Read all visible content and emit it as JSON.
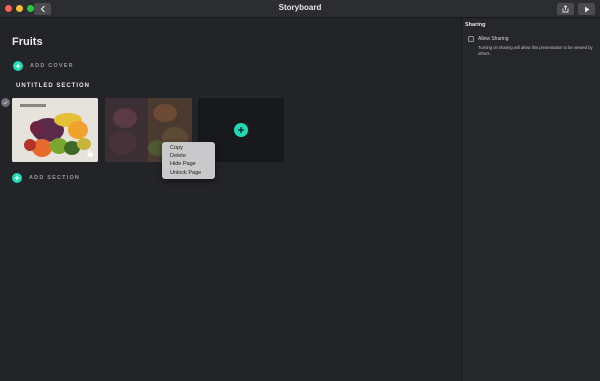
{
  "window": {
    "title": "Storyboard"
  },
  "document": {
    "title": "Fruits",
    "add_cover_label": "ADD COVER",
    "add_section_label": "ADD SECTION",
    "section_title": "UNTITLED SECTION"
  },
  "context_menu": {
    "items": [
      "Copy",
      "Delete",
      "Hide Page",
      "Unlock Page"
    ]
  },
  "sidebar": {
    "header": "Sharing",
    "allow_sharing_label": "Allow Sharing",
    "allow_sharing_checked": false,
    "description": "Turning on sharing will allow this presentation to be viewed by others."
  },
  "colors": {
    "accent": "#1fd9b3",
    "background": "#232428",
    "sidebar": "#26272b"
  },
  "icons": {
    "back": "chevron-left-icon",
    "share": "share-icon",
    "play": "play-icon",
    "add": "plus-icon",
    "lock": "lock-icon"
  }
}
